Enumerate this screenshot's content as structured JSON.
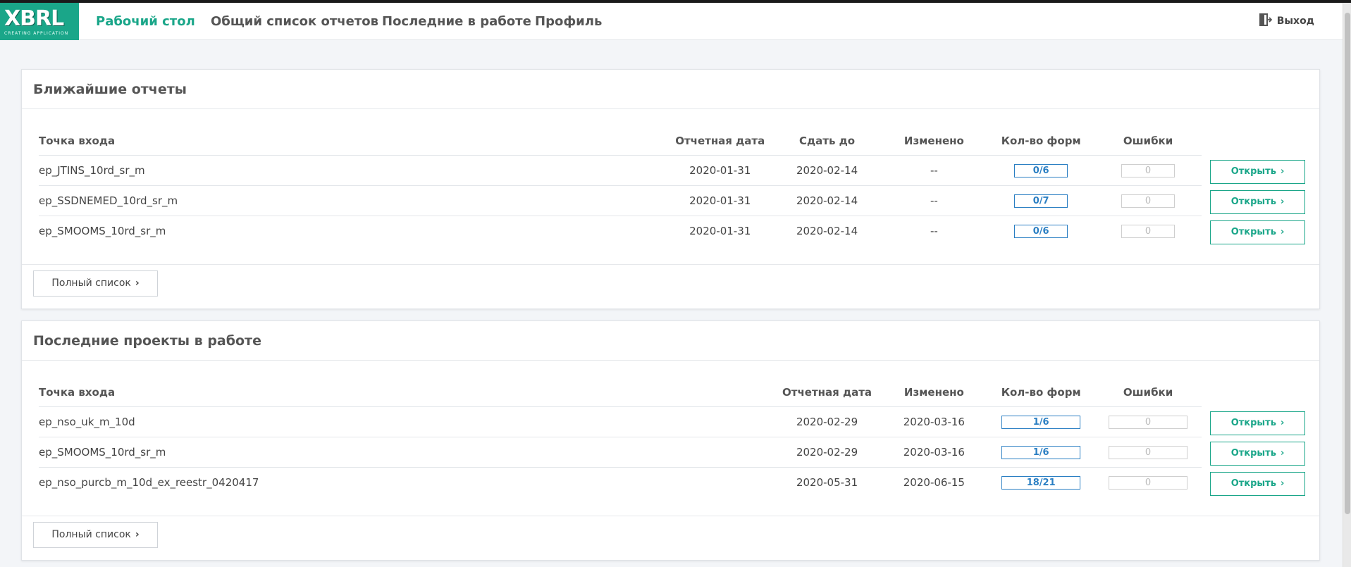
{
  "logo": {
    "main": "XBRL",
    "sub": "CREATING APPLICATION"
  },
  "nav": {
    "items": [
      {
        "label": "Рабочий стол"
      },
      {
        "label": "Общий список отчетов"
      },
      {
        "label": "Последние в работе"
      },
      {
        "label": "Профиль"
      }
    ],
    "logout": "Выход"
  },
  "nearest": {
    "title": "Ближайшие отчеты",
    "columns": [
      "Точка входа",
      "Отчетная дата",
      "Сдать до",
      "Изменено",
      "Кол-во форм",
      "Ошибки"
    ],
    "rows": [
      {
        "entry": "ep_JTINS_10rd_sr_m",
        "report_date": "2020-01-31",
        "due": "2020-02-14",
        "changed": "--",
        "forms": "0/6",
        "errors": "0"
      },
      {
        "entry": "ep_SSDNEMED_10rd_sr_m",
        "report_date": "2020-01-31",
        "due": "2020-02-14",
        "changed": "--",
        "forms": "0/7",
        "errors": "0"
      },
      {
        "entry": "ep_SMOOMS_10rd_sr_m",
        "report_date": "2020-01-31",
        "due": "2020-02-14",
        "changed": "--",
        "forms": "0/6",
        "errors": "0"
      }
    ],
    "open_label": "Открыть",
    "full_list": "Полный список"
  },
  "recent": {
    "title": "Последние проекты в работе",
    "columns": [
      "Точка входа",
      "Отчетная дата",
      "Изменено",
      "Кол-во форм",
      "Ошибки"
    ],
    "rows": [
      {
        "entry": "ep_nso_uk_m_10d",
        "report_date": "2020-02-29",
        "changed": "2020-03-16",
        "forms": "1/6",
        "errors": "0"
      },
      {
        "entry": "ep_SMOOMS_10rd_sr_m",
        "report_date": "2020-02-29",
        "changed": "2020-03-16",
        "forms": "1/6",
        "errors": "0"
      },
      {
        "entry": "ep_nso_purcb_m_10d_ex_reestr_0420417",
        "report_date": "2020-05-31",
        "changed": "2020-06-15",
        "forms": "18/21",
        "errors": "0"
      }
    ],
    "open_label": "Открыть",
    "full_list": "Полный список"
  },
  "colors": {
    "accent": "#1aa689",
    "badge": "#2b7fc3"
  }
}
